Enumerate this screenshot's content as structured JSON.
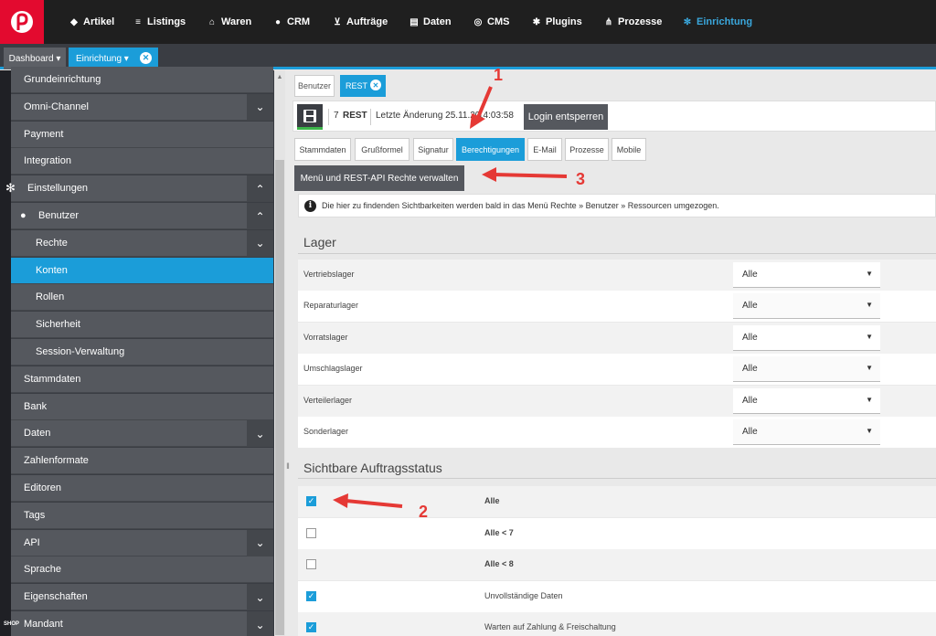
{
  "nav": {
    "items": [
      {
        "label": "Artikel",
        "icon": "tag-icon"
      },
      {
        "label": "Listings",
        "icon": "list-icon"
      },
      {
        "label": "Waren",
        "icon": "warehouse-icon"
      },
      {
        "label": "CRM",
        "icon": "users-icon"
      },
      {
        "label": "Aufträge",
        "icon": "cart-icon"
      },
      {
        "label": "Daten",
        "icon": "database-icon"
      },
      {
        "label": "CMS",
        "icon": "globe-icon"
      },
      {
        "label": "Plugins",
        "icon": "puzzle-icon"
      },
      {
        "label": "Prozesse",
        "icon": "process-icon"
      },
      {
        "label": "Einrichtung",
        "icon": "gear-icon"
      }
    ],
    "active": "Einrichtung",
    "brand_color": "#e30a2f",
    "accent_color": "#1b9dd9"
  },
  "tabbar": {
    "dashboard": "Dashboard ▾",
    "einrichtung": "Einrichtung ▾",
    "close": "✕"
  },
  "sidebar": {
    "items": [
      {
        "label": "Grundeinrichtung"
      },
      {
        "label": "Omni-Channel",
        "chevron": "⌄"
      },
      {
        "label": "Payment"
      },
      {
        "label": "Integration"
      },
      {
        "label": "Einstellungen",
        "chevron": "⌃"
      },
      {
        "label": "Benutzer",
        "chevron": "⌃"
      },
      {
        "label": "Rechte",
        "chevron": "⌄"
      },
      {
        "label": "Konten",
        "active": true
      },
      {
        "label": "Rollen"
      },
      {
        "label": "Sicherheit"
      },
      {
        "label": "Session-Verwaltung"
      },
      {
        "label": "Stammdaten"
      },
      {
        "label": "Bank"
      },
      {
        "label": "Daten",
        "chevron": "⌄"
      },
      {
        "label": "Zahlenformate"
      },
      {
        "label": "Editoren"
      },
      {
        "label": "Tags"
      },
      {
        "label": "API",
        "chevron": "⌄"
      },
      {
        "label": "Sprache"
      },
      {
        "label": "Eigenschaften",
        "chevron": "⌄"
      },
      {
        "label": "Mandant",
        "chevron": "⌄"
      }
    ],
    "shop_badge": "SHOP"
  },
  "content_tabs": {
    "benutzer": "Benutzer",
    "rest": "REST",
    "close": "✕"
  },
  "toolbar": {
    "id": "7",
    "name": "REST",
    "last_change": "Letzte Änderung 25.11.20",
    "time": "14:03:58",
    "login_button": "Login entsperren"
  },
  "subtabs": [
    {
      "label": "Stammdaten"
    },
    {
      "label": "Grußformel"
    },
    {
      "label": "Signatur"
    },
    {
      "label": "Berechtigungen",
      "active": true
    },
    {
      "label": "E-Mail"
    },
    {
      "label": "Prozesse"
    },
    {
      "label": "Mobile"
    }
  ],
  "permissions_button": "Menü und REST-API Rechte verwalten",
  "info_icon": "i",
  "info_text": "Die hier zu findenden Sichtbarkeiten werden bald in das Menü Rechte » Benutzer » Ressourcen umgezogen.",
  "lager": {
    "title": "Lager",
    "rows": [
      {
        "label": "Vertriebslager",
        "value": "Alle"
      },
      {
        "label": "Reparaturlager",
        "value": "Alle"
      },
      {
        "label": "Vorratslager",
        "value": "Alle"
      },
      {
        "label": "Umschlagslager",
        "value": "Alle"
      },
      {
        "label": "Verteilerlager",
        "value": "Alle"
      },
      {
        "label": "Sonderlager",
        "value": "Alle"
      }
    ]
  },
  "auftragsstatus": {
    "title": "Sichtbare Auftragsstatus",
    "rows": [
      {
        "label": "Alle",
        "checked": true,
        "bold": true
      },
      {
        "label": "Alle < 7",
        "checked": false,
        "bold": true
      },
      {
        "label": "Alle < 8",
        "checked": false,
        "bold": true
      },
      {
        "label": "Unvollständige Daten",
        "checked": true,
        "bold": false
      },
      {
        "label": "Warten auf Zahlung & Freischaltung",
        "checked": true,
        "bold": false
      }
    ]
  },
  "annotations": {
    "one": "1",
    "two": "2",
    "three": "3",
    "color": "#e53935"
  }
}
